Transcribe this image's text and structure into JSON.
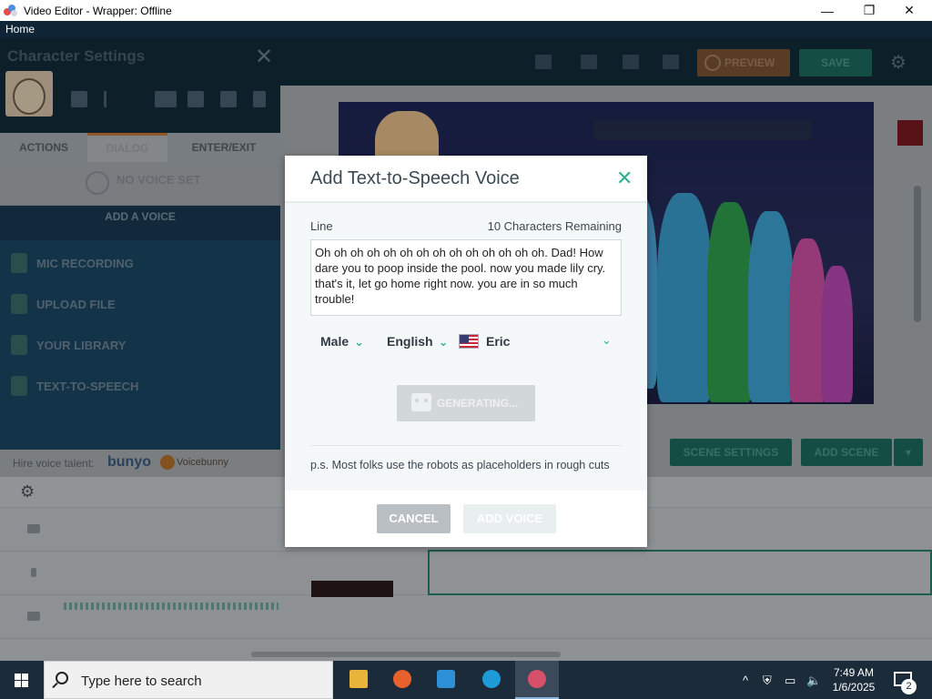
{
  "window": {
    "title": "Video Editor - Wrapper: Offline",
    "minimize_label": "—",
    "restore_label": "❐",
    "close_label": "✕"
  },
  "menubar": {
    "home": "Home"
  },
  "character_panel": {
    "title": "Character Settings",
    "tabs": [
      "ACTIONS",
      "DIALOG",
      "ENTER/EXIT"
    ],
    "no_voice": "NO VOICE SET",
    "add_voice_header": "ADD A VOICE",
    "voice_options": [
      "MIC RECORDING",
      "UPLOAD FILE",
      "YOUR LIBRARY",
      "TEXT-TO-SPEECH"
    ],
    "hire_label": "Hire voice talent:",
    "brand1": "bunyo",
    "brand2": "Voicebunny"
  },
  "toolbar": {
    "preview": "PREVIEW",
    "save": "SAVE"
  },
  "stage_buttons": {
    "scene_settings": "SCENE SETTINGS",
    "add_scene": "ADD SCENE",
    "dropdown": "▾"
  },
  "modal": {
    "title": "Add Text-to-Speech Voice",
    "close": "✕",
    "line_label": "Line",
    "remaining": "10 Characters Remaining",
    "line_text": "Oh oh oh oh oh oh oh oh oh oh oh oh oh oh. Dad! How dare you to poop inside the pool. now you made lily cry. that's it, let go home right now. you are in so much trouble!",
    "gender": "Male",
    "language": "English",
    "voice": "Eric",
    "generating": "GENERATING...",
    "note": "p.s. Most folks use the robots as placeholders in rough cuts",
    "cancel": "CANCEL",
    "add_voice": "ADD VOICE"
  },
  "taskbar": {
    "search_placeholder": "Type here to search",
    "time": "7:49 AM",
    "date": "1/6/2025",
    "notifications": "2"
  },
  "colors": {
    "accent": "#2fb28f",
    "dark_panel": "#132b3a",
    "save_green": "#1d6b5f"
  }
}
